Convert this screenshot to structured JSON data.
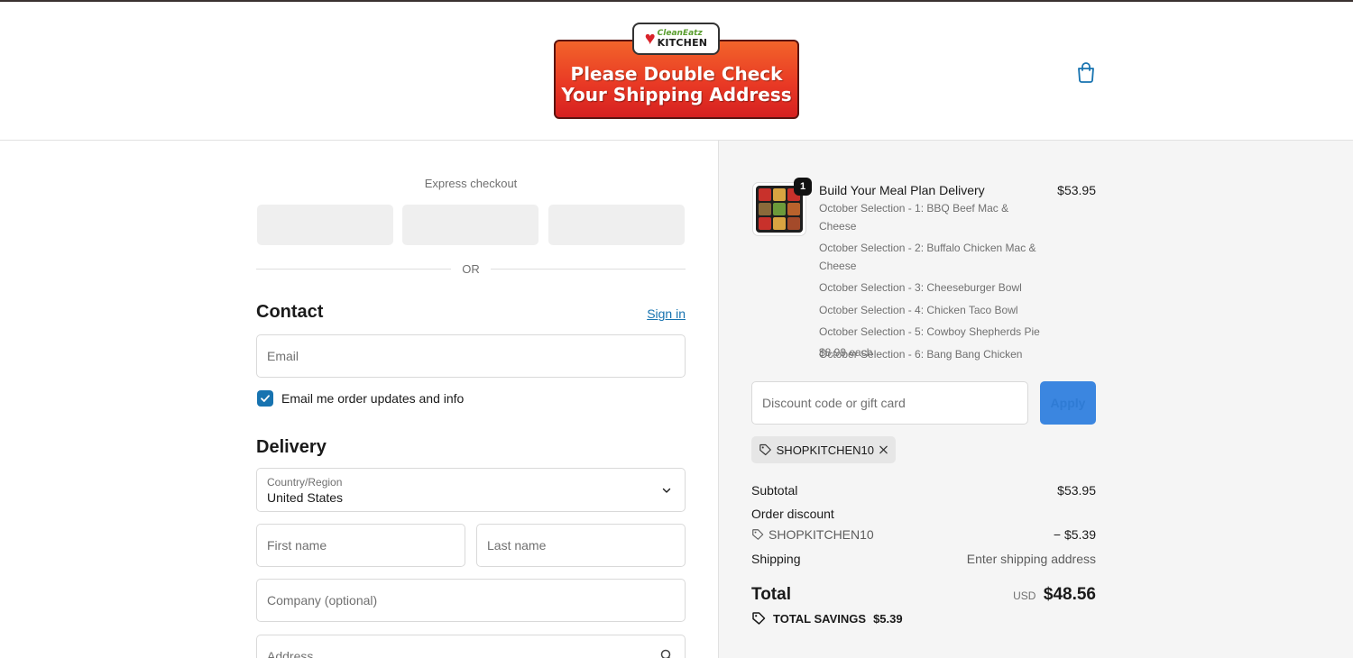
{
  "header": {
    "logo": {
      "line1": "CleanEatz",
      "line2": "KITCHEN"
    },
    "banner": {
      "line1": "Please Double Check",
      "line2": "Your Shipping Address"
    },
    "cart_icon": "shopping-bag-icon"
  },
  "express": {
    "label": "Express checkout",
    "or": "OR"
  },
  "contact": {
    "title": "Contact",
    "sign_in": "Sign in",
    "email_placeholder": "Email",
    "newsletter_label": "Email me order updates and info",
    "newsletter_checked": true
  },
  "delivery": {
    "title": "Delivery",
    "country_label": "Country/Region",
    "country_value": "United States",
    "first_name_placeholder": "First name",
    "last_name_placeholder": "Last name",
    "company_placeholder": "Company (optional)",
    "address_placeholder": "Address"
  },
  "summary": {
    "item": {
      "quantity": "1",
      "title": "Build Your Meal Plan Delivery",
      "price": "$53.95",
      "selections": [
        "October Selection - 1: BBQ Beef Mac & Cheese",
        "October Selection - 2: Buffalo Chicken Mac & Cheese",
        "October Selection - 3: Cheeseburger Bowl",
        "October Selection - 4: Chicken Taco Bowl",
        "October Selection - 5: Cowboy Shepherds Pie",
        "October Selection - 6: Bang Bang Chicken"
      ],
      "each_price": "$8.99 each"
    },
    "discount_placeholder": "Discount code or gift card",
    "apply_label": "Apply",
    "applied_code": "SHOPKITCHEN10",
    "subtotal_label": "Subtotal",
    "subtotal_value": "$53.95",
    "order_discount_label": "Order discount",
    "discount_code": "SHOPKITCHEN10",
    "discount_value": "− $5.39",
    "shipping_label": "Shipping",
    "shipping_value": "Enter shipping address",
    "total_label": "Total",
    "currency": "USD",
    "total_value": "$48.56",
    "savings_label": "TOTAL SAVINGS",
    "savings_value": "$5.39"
  },
  "colors": {
    "accent_link": "#1773b0",
    "apply_button": "#3b86e0",
    "banner_red": "#e93a25",
    "summary_bg": "#f5f5f5"
  }
}
